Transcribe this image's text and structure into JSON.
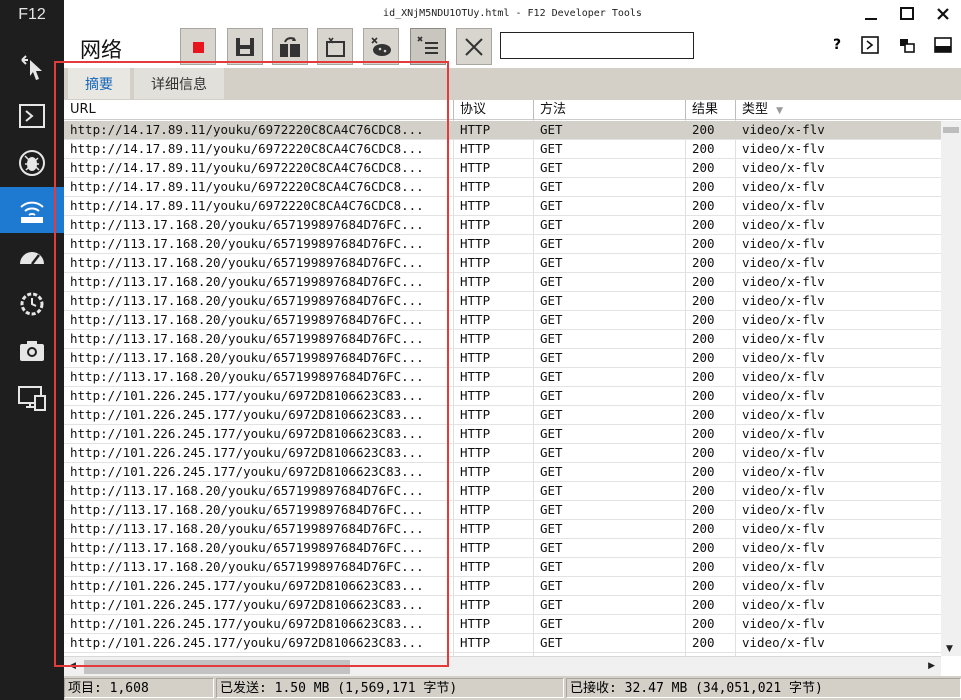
{
  "app": {
    "f12_label": "F12",
    "window_title": "id_XNjM5NDU1OTUy.html - F12 Developer Tools",
    "panel_title": "网络"
  },
  "sidebar": {
    "items": [
      {
        "icon": "dom-explorer-icon"
      },
      {
        "icon": "console-icon"
      },
      {
        "icon": "debugger-icon"
      },
      {
        "icon": "network-icon",
        "active": true
      },
      {
        "icon": "performance-icon"
      },
      {
        "icon": "memory-icon"
      },
      {
        "icon": "emulation-icon"
      },
      {
        "icon": "display-icon"
      }
    ]
  },
  "toolbar": {
    "buttons": [
      "stop-capture-icon",
      "export-icon",
      "always-refresh-icon",
      "clear-cache-icon",
      "clear-cookies-icon",
      "clear-entries-on-navigate-icon",
      "clear-session-icon"
    ],
    "filter_value": "",
    "help_label": "?"
  },
  "tabs": [
    {
      "label": "摘要",
      "active": true
    },
    {
      "label": "详细信息",
      "active": false
    }
  ],
  "table": {
    "columns": [
      "URL",
      "协议",
      "方法",
      "结果",
      "类型"
    ],
    "sort_indicator": "▼",
    "rows": [
      {
        "url": "http://14.17.89.11/youku/6972220C8CA4C76CDC8...",
        "protocol": "HTTP",
        "method": "GET",
        "result": "200",
        "type": "video/x-flv",
        "selected": true
      },
      {
        "url": "http://14.17.89.11/youku/6972220C8CA4C76CDC8...",
        "protocol": "HTTP",
        "method": "GET",
        "result": "200",
        "type": "video/x-flv"
      },
      {
        "url": "http://14.17.89.11/youku/6972220C8CA4C76CDC8...",
        "protocol": "HTTP",
        "method": "GET",
        "result": "200",
        "type": "video/x-flv"
      },
      {
        "url": "http://14.17.89.11/youku/6972220C8CA4C76CDC8...",
        "protocol": "HTTP",
        "method": "GET",
        "result": "200",
        "type": "video/x-flv"
      },
      {
        "url": "http://14.17.89.11/youku/6972220C8CA4C76CDC8...",
        "protocol": "HTTP",
        "method": "GET",
        "result": "200",
        "type": "video/x-flv"
      },
      {
        "url": "http://113.17.168.20/youku/657199897684D76FC...",
        "protocol": "HTTP",
        "method": "GET",
        "result": "200",
        "type": "video/x-flv"
      },
      {
        "url": "http://113.17.168.20/youku/657199897684D76FC...",
        "protocol": "HTTP",
        "method": "GET",
        "result": "200",
        "type": "video/x-flv"
      },
      {
        "url": "http://113.17.168.20/youku/657199897684D76FC...",
        "protocol": "HTTP",
        "method": "GET",
        "result": "200",
        "type": "video/x-flv"
      },
      {
        "url": "http://113.17.168.20/youku/657199897684D76FC...",
        "protocol": "HTTP",
        "method": "GET",
        "result": "200",
        "type": "video/x-flv"
      },
      {
        "url": "http://113.17.168.20/youku/657199897684D76FC...",
        "protocol": "HTTP",
        "method": "GET",
        "result": "200",
        "type": "video/x-flv"
      },
      {
        "url": "http://113.17.168.20/youku/657199897684D76FC...",
        "protocol": "HTTP",
        "method": "GET",
        "result": "200",
        "type": "video/x-flv"
      },
      {
        "url": "http://113.17.168.20/youku/657199897684D76FC...",
        "protocol": "HTTP",
        "method": "GET",
        "result": "200",
        "type": "video/x-flv"
      },
      {
        "url": "http://113.17.168.20/youku/657199897684D76FC...",
        "protocol": "HTTP",
        "method": "GET",
        "result": "200",
        "type": "video/x-flv"
      },
      {
        "url": "http://113.17.168.20/youku/657199897684D76FC...",
        "protocol": "HTTP",
        "method": "GET",
        "result": "200",
        "type": "video/x-flv"
      },
      {
        "url": "http://101.226.245.177/youku/6972D8106623C83...",
        "protocol": "HTTP",
        "method": "GET",
        "result": "200",
        "type": "video/x-flv"
      },
      {
        "url": "http://101.226.245.177/youku/6972D8106623C83...",
        "protocol": "HTTP",
        "method": "GET",
        "result": "200",
        "type": "video/x-flv"
      },
      {
        "url": "http://101.226.245.177/youku/6972D8106623C83...",
        "protocol": "HTTP",
        "method": "GET",
        "result": "200",
        "type": "video/x-flv"
      },
      {
        "url": "http://101.226.245.177/youku/6972D8106623C83...",
        "protocol": "HTTP",
        "method": "GET",
        "result": "200",
        "type": "video/x-flv"
      },
      {
        "url": "http://101.226.245.177/youku/6972D8106623C83...",
        "protocol": "HTTP",
        "method": "GET",
        "result": "200",
        "type": "video/x-flv"
      },
      {
        "url": "http://113.17.168.20/youku/657199897684D76FC...",
        "protocol": "HTTP",
        "method": "GET",
        "result": "200",
        "type": "video/x-flv"
      },
      {
        "url": "http://113.17.168.20/youku/657199897684D76FC...",
        "protocol": "HTTP",
        "method": "GET",
        "result": "200",
        "type": "video/x-flv"
      },
      {
        "url": "http://113.17.168.20/youku/657199897684D76FC...",
        "protocol": "HTTP",
        "method": "GET",
        "result": "200",
        "type": "video/x-flv"
      },
      {
        "url": "http://113.17.168.20/youku/657199897684D76FC...",
        "protocol": "HTTP",
        "method": "GET",
        "result": "200",
        "type": "video/x-flv"
      },
      {
        "url": "http://113.17.168.20/youku/657199897684D76FC...",
        "protocol": "HTTP",
        "method": "GET",
        "result": "200",
        "type": "video/x-flv"
      },
      {
        "url": "http://101.226.245.177/youku/6972D8106623C83...",
        "protocol": "HTTP",
        "method": "GET",
        "result": "200",
        "type": "video/x-flv"
      },
      {
        "url": "http://101.226.245.177/youku/6972D8106623C83...",
        "protocol": "HTTP",
        "method": "GET",
        "result": "200",
        "type": "video/x-flv"
      },
      {
        "url": "http://101.226.245.177/youku/6972D8106623C83...",
        "protocol": "HTTP",
        "method": "GET",
        "result": "200",
        "type": "video/x-flv"
      },
      {
        "url": "http://101.226.245.177/youku/6972D8106623C83...",
        "protocol": "HTTP",
        "method": "GET",
        "result": "200",
        "type": "video/x-flv"
      }
    ]
  },
  "statusbar": {
    "items": "项目: 1,608",
    "sent": "已发送: 1.50 MB (1,569,171 字节)",
    "received": "已接收: 32.47 MB (34,051,021 字节)"
  },
  "colors": {
    "sidebar_bg": "#1e1e1e",
    "sidebar_active": "#1e7ad0",
    "toolbar_button_bg": "#d8d5ce",
    "selected_row": "#d3d0c9",
    "annotation_red": "#e33b3b",
    "tab_active_text": "#1565b8"
  }
}
